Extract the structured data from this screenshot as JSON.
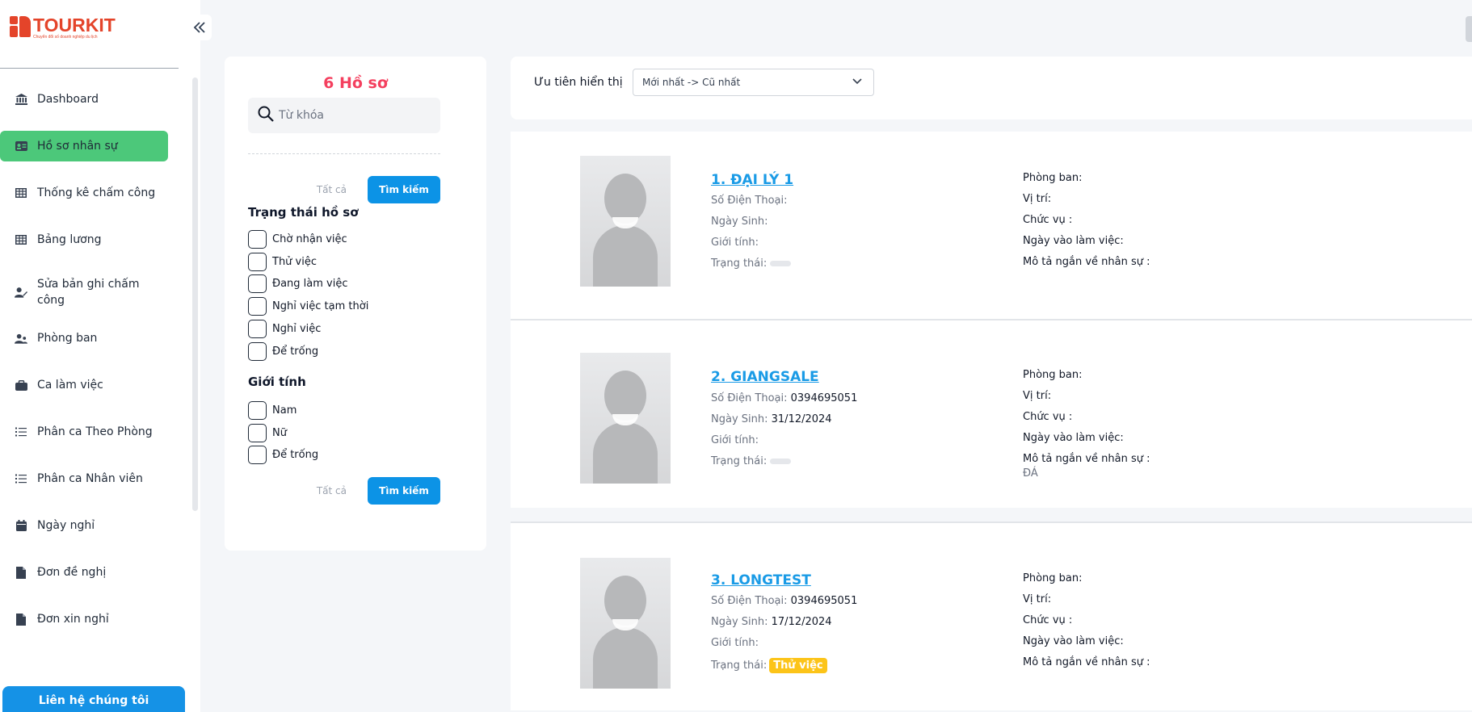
{
  "brand": {
    "name": "TOURKIT",
    "tagline": "Chuyển đổi số doanh nghiệp du lịch"
  },
  "sidebar": {
    "items": [
      {
        "label": "Dashboard",
        "icon": "bank-icon"
      },
      {
        "label": "Hồ sơ nhân sự",
        "icon": "id-card-icon",
        "active": true
      },
      {
        "label": "Thống kê chấm công",
        "icon": "table-icon"
      },
      {
        "label": "Bảng lương",
        "icon": "table-icon"
      },
      {
        "label": "Sửa bản ghi chấm công",
        "icon": "user-edit-icon"
      },
      {
        "label": "Phòng ban",
        "icon": "users-icon"
      },
      {
        "label": "Ca làm việc",
        "icon": "briefcase-icon"
      },
      {
        "label": "Phân ca Theo Phòng",
        "icon": "list-icon"
      },
      {
        "label": "Phân ca Nhân viên",
        "icon": "list-icon"
      },
      {
        "label": "Ngày nghỉ",
        "icon": "calendar-icon"
      },
      {
        "label": "Đơn đề nghị",
        "icon": "document-icon"
      },
      {
        "label": "Đơn xin nghỉ",
        "icon": "document-icon"
      }
    ],
    "contact_button": "Liên hệ chúng tôi"
  },
  "filter": {
    "count_text": "6 Hồ sơ",
    "search_placeholder": "Từ khóa",
    "all_label": "Tất cả",
    "search_button": "Tìm kiếm",
    "status_title": "Trạng thái hồ sơ",
    "status_options": [
      "Chờ nhận việc",
      "Thử việc",
      "Đang làm việc",
      "Nghỉ việc tạm thời",
      "Nghỉ việc",
      "Để trống"
    ],
    "gender_title": "Giới tính",
    "gender_options": [
      "Nam",
      "Nữ",
      "Để trống"
    ]
  },
  "sort": {
    "label": "Ưu tiên hiển thị",
    "selected": "Mới nhất -> Cũ nhất"
  },
  "labels": {
    "phone": "Số Điện Thoại:",
    "dob": "Ngày Sinh:",
    "gender": "Giới tính:",
    "status": "Trạng thái:",
    "department": "Phòng ban:",
    "position": "Vị trí:",
    "title": "Chức vụ :",
    "start_date": "Ngày vào làm việc:",
    "description": "Mô tả ngắn về nhân sự :"
  },
  "employees": [
    {
      "name": "1. ĐẠI LÝ 1",
      "phone": "",
      "dob": "",
      "gender": "",
      "status": "",
      "note": ""
    },
    {
      "name": "2. GIANGSALE",
      "phone": "0394695051",
      "dob": "31/12/2024",
      "gender": "",
      "status": "",
      "note": "ĐÁ"
    },
    {
      "name": "3. LONGTEST",
      "phone": "0394695051",
      "dob": "17/12/2024",
      "gender": "",
      "status": "Thử việc",
      "note": ""
    }
  ],
  "colors": {
    "accent": "#4cc87a",
    "primary": "#0c93e6",
    "count": "#f43f5e",
    "badge": "#fcc419"
  }
}
